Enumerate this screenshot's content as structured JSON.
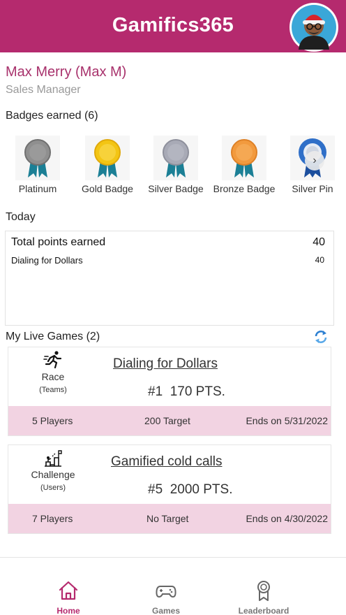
{
  "app": {
    "title": "Gamifics365"
  },
  "profile": {
    "name": "Max Merry (Max M)",
    "role": "Sales Manager"
  },
  "badges": {
    "heading": "Badges earned (6)",
    "items": [
      {
        "label": "Platinum",
        "color": "#8f8f8f"
      },
      {
        "label": "Gold Badge",
        "color": "#f3c514"
      },
      {
        "label": "Silver Badge",
        "color": "#a8aab6"
      },
      {
        "label": "Bronze Badge",
        "color": "#f29a3e"
      },
      {
        "label": "Silver Pin",
        "color": "#2f6fc8"
      }
    ]
  },
  "today": {
    "heading": "Today",
    "total_label": "Total points earned",
    "total_value": "40",
    "items": [
      {
        "label": "Dialing for Dollars",
        "points": "40"
      }
    ]
  },
  "live_games": {
    "heading": "My Live Games (2)",
    "games": [
      {
        "type": "Race",
        "subtype": "(Teams)",
        "name": "Dialing for Dollars",
        "rank": "#1",
        "points": "170 PTS.",
        "players": "5 Players",
        "target": "200 Target",
        "ends": "Ends on 5/31/2022"
      },
      {
        "type": "Challenge",
        "subtype": "(Users)",
        "name": "Gamified cold calls",
        "rank": "#5",
        "points": "2000 PTS.",
        "players": "7 Players",
        "target": "No Target",
        "ends": "Ends on 4/30/2022"
      }
    ]
  },
  "nav": {
    "items": [
      {
        "label": "Home",
        "icon": "home-icon",
        "active": true
      },
      {
        "label": "Games",
        "icon": "gamepad-icon",
        "active": false
      },
      {
        "label": "Leaderboard",
        "icon": "award-icon",
        "active": false
      }
    ]
  },
  "colors": {
    "brand": "#b52a6e",
    "footer_band": "#f2d3e2",
    "ribbon": "#1b7f95"
  }
}
